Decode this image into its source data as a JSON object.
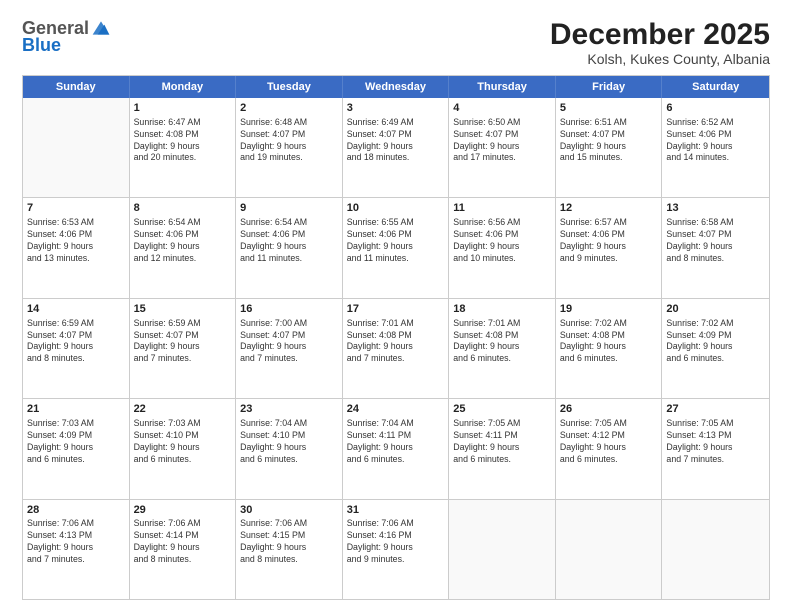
{
  "logo": {
    "general": "General",
    "blue": "Blue"
  },
  "title": {
    "month": "December 2025",
    "location": "Kolsh, Kukes County, Albania"
  },
  "header_days": [
    "Sunday",
    "Monday",
    "Tuesday",
    "Wednesday",
    "Thursday",
    "Friday",
    "Saturday"
  ],
  "rows": [
    [
      {
        "day": "",
        "info": ""
      },
      {
        "day": "1",
        "info": "Sunrise: 6:47 AM\nSunset: 4:08 PM\nDaylight: 9 hours\nand 20 minutes."
      },
      {
        "day": "2",
        "info": "Sunrise: 6:48 AM\nSunset: 4:07 PM\nDaylight: 9 hours\nand 19 minutes."
      },
      {
        "day": "3",
        "info": "Sunrise: 6:49 AM\nSunset: 4:07 PM\nDaylight: 9 hours\nand 18 minutes."
      },
      {
        "day": "4",
        "info": "Sunrise: 6:50 AM\nSunset: 4:07 PM\nDaylight: 9 hours\nand 17 minutes."
      },
      {
        "day": "5",
        "info": "Sunrise: 6:51 AM\nSunset: 4:07 PM\nDaylight: 9 hours\nand 15 minutes."
      },
      {
        "day": "6",
        "info": "Sunrise: 6:52 AM\nSunset: 4:06 PM\nDaylight: 9 hours\nand 14 minutes."
      }
    ],
    [
      {
        "day": "7",
        "info": "Sunrise: 6:53 AM\nSunset: 4:06 PM\nDaylight: 9 hours\nand 13 minutes."
      },
      {
        "day": "8",
        "info": "Sunrise: 6:54 AM\nSunset: 4:06 PM\nDaylight: 9 hours\nand 12 minutes."
      },
      {
        "day": "9",
        "info": "Sunrise: 6:54 AM\nSunset: 4:06 PM\nDaylight: 9 hours\nand 11 minutes."
      },
      {
        "day": "10",
        "info": "Sunrise: 6:55 AM\nSunset: 4:06 PM\nDaylight: 9 hours\nand 11 minutes."
      },
      {
        "day": "11",
        "info": "Sunrise: 6:56 AM\nSunset: 4:06 PM\nDaylight: 9 hours\nand 10 minutes."
      },
      {
        "day": "12",
        "info": "Sunrise: 6:57 AM\nSunset: 4:06 PM\nDaylight: 9 hours\nand 9 minutes."
      },
      {
        "day": "13",
        "info": "Sunrise: 6:58 AM\nSunset: 4:07 PM\nDaylight: 9 hours\nand 8 minutes."
      }
    ],
    [
      {
        "day": "14",
        "info": "Sunrise: 6:59 AM\nSunset: 4:07 PM\nDaylight: 9 hours\nand 8 minutes."
      },
      {
        "day": "15",
        "info": "Sunrise: 6:59 AM\nSunset: 4:07 PM\nDaylight: 9 hours\nand 7 minutes."
      },
      {
        "day": "16",
        "info": "Sunrise: 7:00 AM\nSunset: 4:07 PM\nDaylight: 9 hours\nand 7 minutes."
      },
      {
        "day": "17",
        "info": "Sunrise: 7:01 AM\nSunset: 4:08 PM\nDaylight: 9 hours\nand 7 minutes."
      },
      {
        "day": "18",
        "info": "Sunrise: 7:01 AM\nSunset: 4:08 PM\nDaylight: 9 hours\nand 6 minutes."
      },
      {
        "day": "19",
        "info": "Sunrise: 7:02 AM\nSunset: 4:08 PM\nDaylight: 9 hours\nand 6 minutes."
      },
      {
        "day": "20",
        "info": "Sunrise: 7:02 AM\nSunset: 4:09 PM\nDaylight: 9 hours\nand 6 minutes."
      }
    ],
    [
      {
        "day": "21",
        "info": "Sunrise: 7:03 AM\nSunset: 4:09 PM\nDaylight: 9 hours\nand 6 minutes."
      },
      {
        "day": "22",
        "info": "Sunrise: 7:03 AM\nSunset: 4:10 PM\nDaylight: 9 hours\nand 6 minutes."
      },
      {
        "day": "23",
        "info": "Sunrise: 7:04 AM\nSunset: 4:10 PM\nDaylight: 9 hours\nand 6 minutes."
      },
      {
        "day": "24",
        "info": "Sunrise: 7:04 AM\nSunset: 4:11 PM\nDaylight: 9 hours\nand 6 minutes."
      },
      {
        "day": "25",
        "info": "Sunrise: 7:05 AM\nSunset: 4:11 PM\nDaylight: 9 hours\nand 6 minutes."
      },
      {
        "day": "26",
        "info": "Sunrise: 7:05 AM\nSunset: 4:12 PM\nDaylight: 9 hours\nand 6 minutes."
      },
      {
        "day": "27",
        "info": "Sunrise: 7:05 AM\nSunset: 4:13 PM\nDaylight: 9 hours\nand 7 minutes."
      }
    ],
    [
      {
        "day": "28",
        "info": "Sunrise: 7:06 AM\nSunset: 4:13 PM\nDaylight: 9 hours\nand 7 minutes."
      },
      {
        "day": "29",
        "info": "Sunrise: 7:06 AM\nSunset: 4:14 PM\nDaylight: 9 hours\nand 8 minutes."
      },
      {
        "day": "30",
        "info": "Sunrise: 7:06 AM\nSunset: 4:15 PM\nDaylight: 9 hours\nand 8 minutes."
      },
      {
        "day": "31",
        "info": "Sunrise: 7:06 AM\nSunset: 4:16 PM\nDaylight: 9 hours\nand 9 minutes."
      },
      {
        "day": "",
        "info": ""
      },
      {
        "day": "",
        "info": ""
      },
      {
        "day": "",
        "info": ""
      }
    ]
  ]
}
